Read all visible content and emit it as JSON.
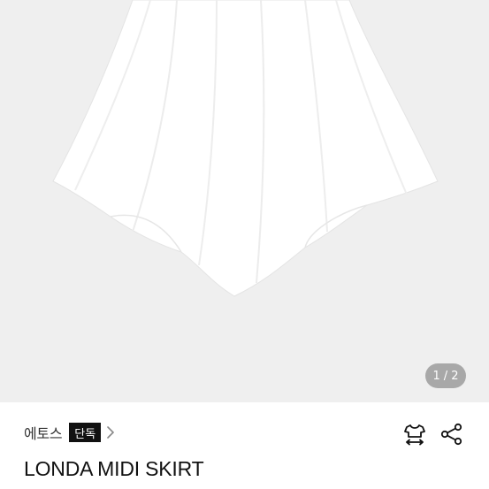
{
  "gallery": {
    "current_page": "1",
    "separator": "/",
    "total_pages": "2"
  },
  "brand": {
    "name": "에토스",
    "badge": "단독"
  },
  "product": {
    "name": "LONDA MIDI SKIRT"
  },
  "icons": {
    "brand_chevron": "chevron-right-icon",
    "size_guide": "shirt-size-icon",
    "share": "share-icon"
  },
  "colors": {
    "gallery_background": "#efefef",
    "badge_background": "#111111",
    "badge_text": "#ffffff"
  }
}
